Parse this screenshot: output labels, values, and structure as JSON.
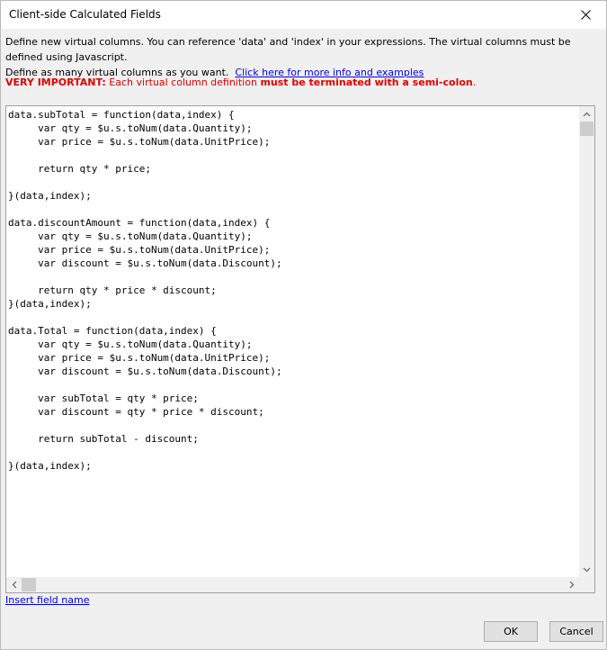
{
  "window": {
    "title": "Client-side Calculated Fields"
  },
  "description": {
    "line1": "Define new virtual columns. You can reference 'data' and 'index' in your expressions. The virtual columns must be defined using Javascript.",
    "line2": "Define as many virtual columns as you want.",
    "link": "Click here for more info and examples"
  },
  "important": {
    "label": "VERY IMPORTANT:",
    "text": " Each virtual column definition ",
    "emphasis": "must be terminated with a semi-colon",
    "end": "."
  },
  "editor": {
    "code": "data.subTotal = function(data,index) {\n     var qty = $u.s.toNum(data.Quantity);\n     var price = $u.s.toNum(data.UnitPrice);\n\n     return qty * price;\n\n}(data,index);\n\ndata.discountAmount = function(data,index) {\n     var qty = $u.s.toNum(data.Quantity);\n     var price = $u.s.toNum(data.UnitPrice);\n     var discount = $u.s.toNum(data.Discount);\n\n     return qty * price * discount;\n}(data,index);\n\ndata.Total = function(data,index) {\n     var qty = $u.s.toNum(data.Quantity);\n     var price = $u.s.toNum(data.UnitPrice);\n     var discount = $u.s.toNum(data.Discount);\n\n     var subTotal = qty * price;\n     var discount = qty * price * discount;\n\n     return subTotal - discount;\n\n}(data,index);"
  },
  "insert_field_link": "Insert field name",
  "buttons": {
    "ok": "OK",
    "cancel": "Cancel"
  },
  "icons": {
    "close": "close-icon",
    "scroll_up": "chevron-up-icon",
    "scroll_down": "chevron-down-icon",
    "scroll_left": "chevron-left-icon",
    "scroll_right": "chevron-right-icon"
  },
  "colors": {
    "important": "#e00000",
    "link": "#0000ee"
  }
}
